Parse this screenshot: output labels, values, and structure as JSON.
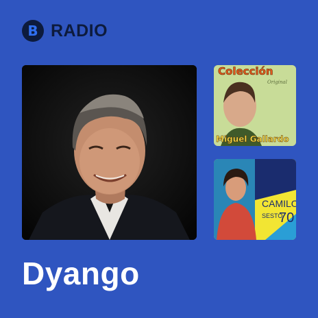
{
  "brand": {
    "label": "RADIO",
    "logo_glyph": "B",
    "logo_icon": "radio-logo-icon"
  },
  "station": {
    "name": "Dyango"
  },
  "album_covers": [
    {
      "title": "Colección",
      "subtitle": "Original",
      "artist": "Miguel Gallardo"
    },
    {
      "artist": "CAMILO",
      "subtitle": "SESTO",
      "number": "70"
    }
  ],
  "colors": {
    "background": "#2f55c0",
    "logo_bg": "#0d1b3d",
    "logo_fg": "#2f6ff0",
    "title": "#ffffff"
  }
}
